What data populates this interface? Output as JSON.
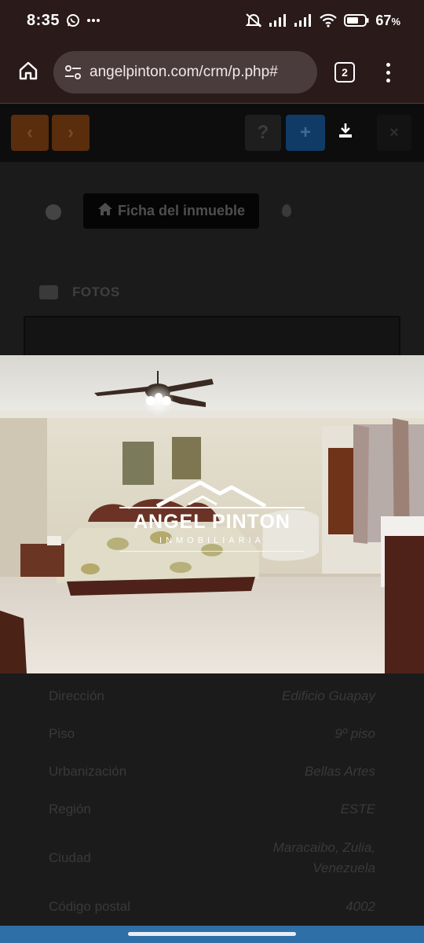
{
  "status_bar": {
    "time": "8:35",
    "battery": "67",
    "battery_unit": "%",
    "icons": [
      "whatsapp-icon",
      "more-notifications-icon",
      "mute-icon",
      "signal-icon",
      "signal-icon",
      "wifi-icon",
      "battery-icon"
    ]
  },
  "browser": {
    "url": "angelpinton.com/crm/p.php#",
    "tab_count": "2",
    "icons": [
      "home-icon",
      "site-settings-icon",
      "menu-icon"
    ]
  },
  "page": {
    "toolbar": {
      "prev": "‹",
      "next": "›",
      "help": "?",
      "add": "+",
      "close": "×"
    },
    "ficha_button": "Ficha del inmueble",
    "fotos_label": "FOTOS",
    "details": [
      {
        "label": "Dirección",
        "value": "Edificio Guapay"
      },
      {
        "label": "Piso",
        "value": "9º piso"
      },
      {
        "label": "Urbanización",
        "value": "Bellas Artes"
      },
      {
        "label": "Región",
        "value": "ESTE"
      },
      {
        "label": "Ciudad",
        "value": "Maracaibo, Zulia, Venezuela"
      },
      {
        "label": "Código postal",
        "value": "4002"
      }
    ]
  },
  "photo": {
    "logo_name": "ANGEL PINTON",
    "logo_sub": "INMOBILIARIA"
  },
  "colors": {
    "browser_bg": "#2a1a1a",
    "url_field": "#4a3c3c",
    "nav_bar": "#2f6fa8",
    "accent_orange": "#5a2d0c",
    "accent_blue": "#0f3b66"
  }
}
